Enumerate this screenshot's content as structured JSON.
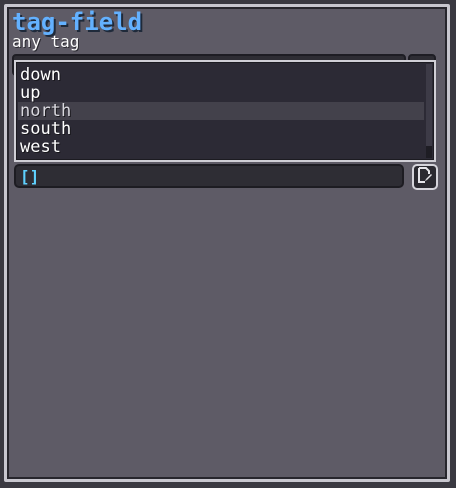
{
  "window": {
    "title": "tag-field",
    "subtitle": "any tag"
  },
  "dropdown": {
    "items": [
      {
        "label": "down",
        "highlighted": false
      },
      {
        "label": "up",
        "highlighted": false
      },
      {
        "label": "north",
        "highlighted": true
      },
      {
        "label": "south",
        "highlighted": false
      },
      {
        "label": "west",
        "highlighted": false
      }
    ]
  },
  "input": {
    "value": "[]"
  },
  "icons": {
    "edit": "edit-icon"
  },
  "colors": {
    "title": "#63b1ff",
    "input_value": "#5fd1ff",
    "highlight_row": "#43414b"
  }
}
